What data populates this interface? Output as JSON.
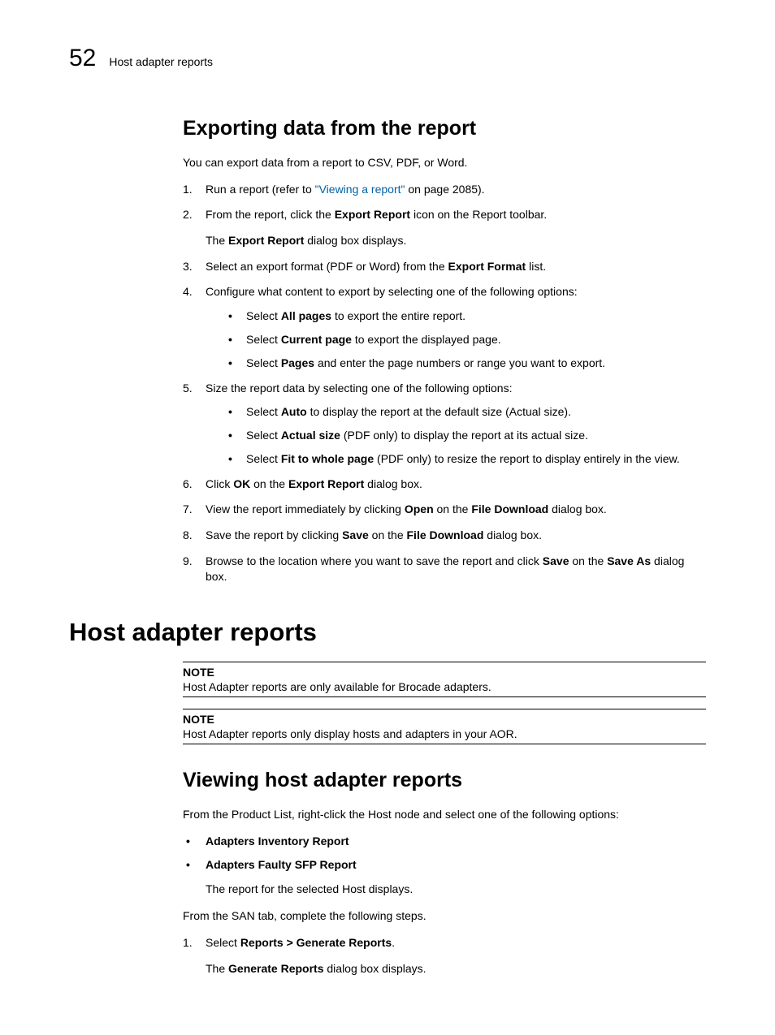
{
  "runningHead": {
    "number": "52",
    "text": "Host adapter reports"
  },
  "sec1": {
    "title": "Exporting data from the report",
    "intro": "You can export data from a report to CSV, PDF, or Word.",
    "steps": [
      {
        "n": "1.",
        "pre": "Run a report (refer to ",
        "linkText": "\"Viewing a report\"",
        "post": " on page 2085)."
      },
      {
        "n": "2.",
        "t1a": "From the report, click the ",
        "b1": "Export Report",
        "t1b": " icon on the Report toolbar.",
        "sub_a": "The ",
        "sub_b": "Export Report",
        "sub_c": " dialog box displays."
      },
      {
        "n": "3.",
        "a": "Select an export format (PDF or Word) from the ",
        "b": "Export Format",
        "c": " list."
      },
      {
        "n": "4.",
        "lead": "Configure what content to export by selecting one of the following options:",
        "bullets": [
          {
            "a": "Select ",
            "b": "All pages",
            "c": " to export the entire report."
          },
          {
            "a": "Select ",
            "b": "Current page",
            "c": " to export the displayed page."
          },
          {
            "a": "Select ",
            "b": "Pages",
            "c": " and enter the page numbers or range you want to export."
          }
        ]
      },
      {
        "n": "5.",
        "lead": "Size the report data by selecting one of the following options:",
        "bullets": [
          {
            "a": "Select ",
            "b": "Auto",
            "c": " to display the report at the default size (Actual size)."
          },
          {
            "a": "Select ",
            "b": "Actual size",
            "c": " (PDF only) to display the report at its actual size."
          },
          {
            "a": "Select ",
            "b": "Fit to whole page",
            "c": " (PDF only) to resize the report to display entirely in the view."
          }
        ]
      },
      {
        "n": "6.",
        "a": "Click ",
        "b": "OK",
        "c": " on the ",
        "d": "Export Report",
        "e": " dialog box."
      },
      {
        "n": "7.",
        "a1": "View the report immediately by clicking ",
        "b1": "Open",
        "a2": " on the ",
        "b2": "File Download",
        "a3": " dialog box."
      },
      {
        "n": "8.",
        "a1": "Save the report by clicking ",
        "b1": "Save",
        "a2": " on the ",
        "b2": "File Download",
        "a3": " dialog box."
      },
      {
        "n": "9.",
        "a1": "Browse to the location where you want to save the report and click ",
        "b1": "Save",
        "a2": " on the ",
        "b2": "Save As",
        "a3": " dialog box."
      }
    ]
  },
  "sec2": {
    "title": "Host adapter reports",
    "note1": {
      "label": "NOTE",
      "text": "Host Adapter reports are only available for Brocade adapters."
    },
    "note2": {
      "label": "NOTE",
      "text": "Host Adapter reports only display hosts and adapters in your AOR."
    },
    "sub": {
      "title": "Viewing host adapter reports",
      "p1": "From the Product List, right-click the Host node and select one of the following options:",
      "opts": [
        "Adapters Inventory Report",
        "Adapters Faulty SFP Report"
      ],
      "afterOpts": "The report for the selected Host displays.",
      "p2": "From the SAN tab, complete the following steps.",
      "step1": {
        "n": "1.",
        "a": "Select ",
        "b": "Reports > Generate Reports",
        "c": ".",
        "sub_a": "The ",
        "sub_b": "Generate Reports",
        "sub_c": " dialog box displays."
      }
    }
  }
}
